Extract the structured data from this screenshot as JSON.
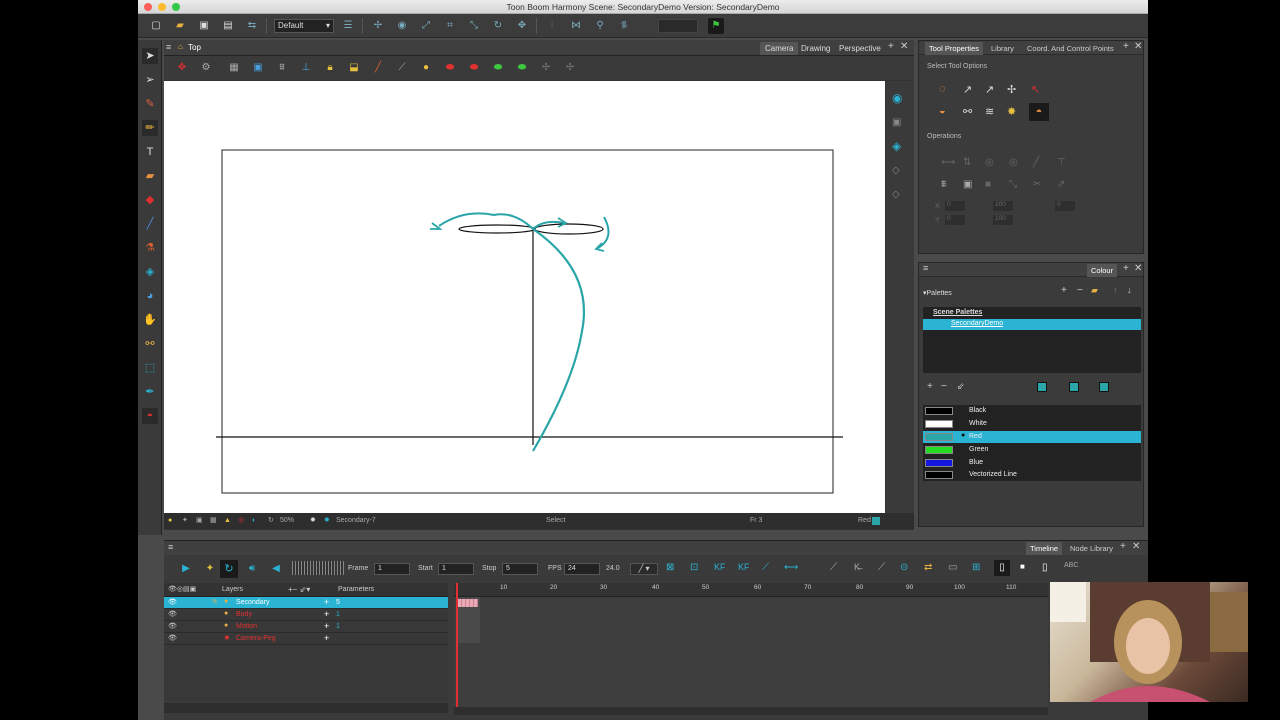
{
  "window": {
    "title": "Toon Boom Harmony Scene: SecondaryDemo Version: SecondaryDemo"
  },
  "toolbar": {
    "workspace": "Default"
  },
  "camera_view": {
    "title": "Top",
    "tabs": [
      "Camera",
      "Drawing",
      "Perspective"
    ],
    "status": {
      "zoom": "50%",
      "drawing": "Secondary-7",
      "tool": "Select",
      "frame": "Fr 3",
      "colour": "Red"
    }
  },
  "tool_properties": {
    "tabs": [
      "Tool Properties",
      "Library",
      "Coord. And Control Points"
    ],
    "select_options": "Select Tool Options",
    "operations": "Operations",
    "fields": {
      "x": "0",
      "y": "0",
      "w": "100",
      "h": "100",
      "a": "0"
    }
  },
  "colour_panel": {
    "tab": "Colour",
    "palettes_label": "Palettes",
    "scene_palettes": "Scene Palettes",
    "palette_name": "SecondaryDemo",
    "colours": [
      {
        "name": "Black",
        "hex": "#000000"
      },
      {
        "name": "White",
        "hex": "#ffffff"
      },
      {
        "name": "Red",
        "hex": "#2aa5a8"
      },
      {
        "name": "Green",
        "hex": "#22dd22"
      },
      {
        "name": "Blue",
        "hex": "#1515e0"
      },
      {
        "name": "Vectorized Line",
        "hex": "#000000"
      }
    ]
  },
  "timeline": {
    "tabs": [
      "Timeline",
      "Node Library"
    ],
    "frame_label": "Frame",
    "frame": "1",
    "start_label": "Start",
    "start": "1",
    "stop_label": "Stop",
    "stop": "5",
    "fps_label": "FPS",
    "fps": "24",
    "fps_actual": "24.0",
    "layers_header": "Layers",
    "params_header": "Parameters",
    "layers": [
      {
        "name": "Secondary",
        "param": "5",
        "color": "#ffffff"
      },
      {
        "name": "Body",
        "param": "1",
        "color": "#e03030"
      },
      {
        "name": "Motion",
        "param": "1",
        "color": "#e03030"
      },
      {
        "name": "Camera-Peg",
        "param": "",
        "color": "#e03030"
      }
    ],
    "ruler": [
      "10",
      "20",
      "30",
      "40",
      "50",
      "60",
      "70",
      "80",
      "90",
      "100",
      "110"
    ]
  }
}
